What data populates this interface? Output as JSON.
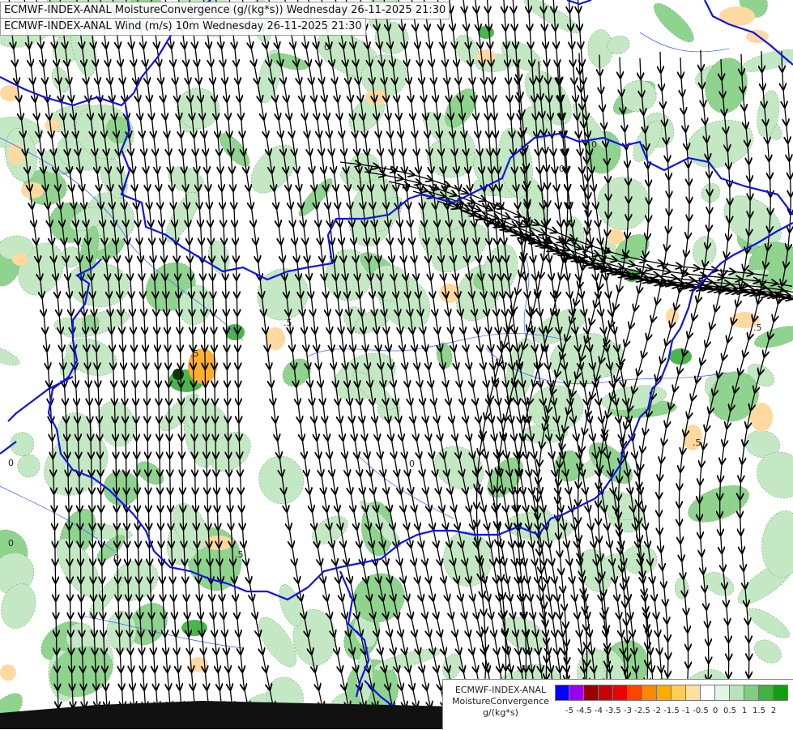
{
  "titles": {
    "line1": "ECMWF-INDEX-ANAL MoistureConvergence (g/(kg*s)) Wednesday 26-11-2025 21:30",
    "line2": "ECMWF-INDEX-ANAL Wind (m/s) 10m Wednesday 26-11-2025 21:30"
  },
  "legend": {
    "title_lines": [
      "ECMWF-INDEX-ANAL",
      "MoistureConvergence",
      "g/(kg*s)"
    ],
    "ticks": [
      "-5",
      "-4.5",
      "-4",
      "-3.5",
      "-3",
      "-2.5",
      "-2",
      "-1.5",
      "-1",
      "-0.5",
      "0",
      "0.5",
      "1",
      "1.5",
      "2"
    ],
    "colors": [
      "#0000ff",
      "#9900ee",
      "#990000",
      "#cc0000",
      "#ee0000",
      "#ff4400",
      "#ff8800",
      "#ffaa00",
      "#ffcc55",
      "#ffe0a0",
      "#ffffff",
      "#e4f4e4",
      "#b8e3b8",
      "#7fcf7f",
      "#3fb23f",
      "#109f10"
    ]
  },
  "contour_labels": [
    "0",
    "0",
    "0",
    ".5",
    ".5",
    ".5",
    ".5",
    ".5",
    "0",
    "0",
    "0",
    "0"
  ],
  "colors": {
    "border": "#1111ee",
    "river": "#4d6cff",
    "streamline": "#000000",
    "green_light": "#c4e8c4",
    "green_mid": "#8fd38f",
    "green_dark": "#4cb44c",
    "orange_light": "#ffd9a0",
    "orange_mid": "#ffb030"
  }
}
